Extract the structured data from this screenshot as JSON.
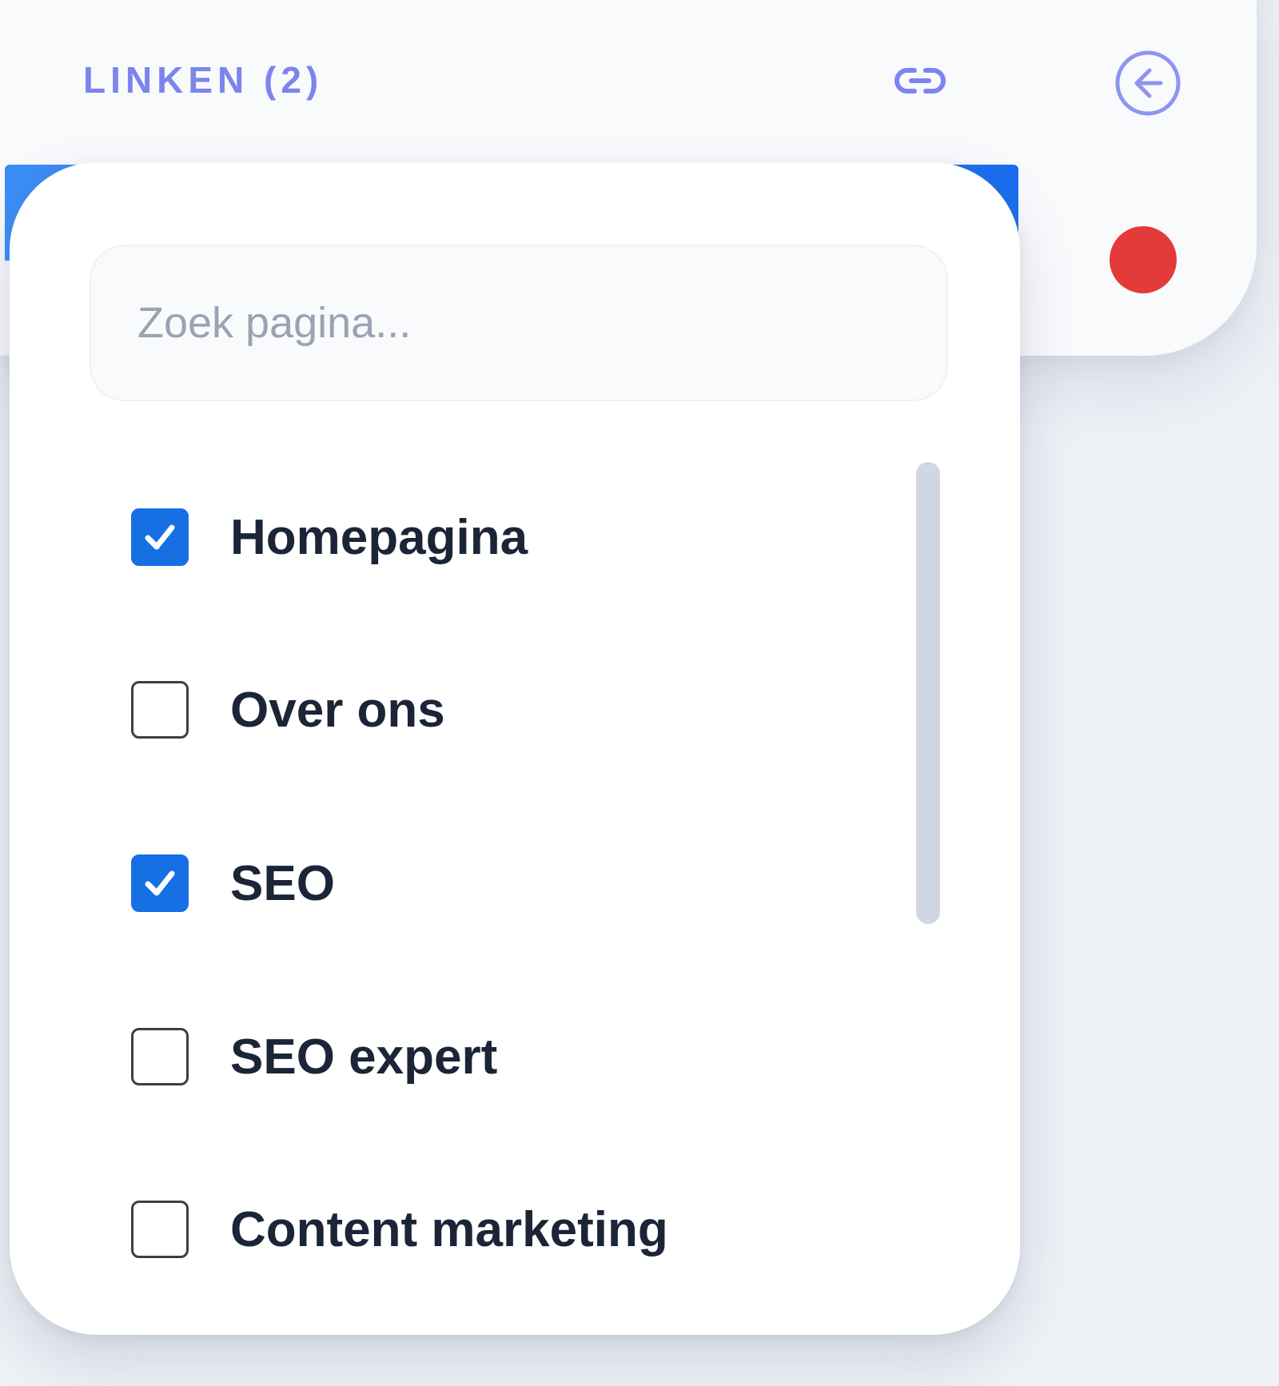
{
  "header": {
    "title": "LINKEN (2)",
    "link_icon": "link-icon",
    "back_icon": "arrow-left-circle-icon"
  },
  "status": {
    "color": "#e53a3a"
  },
  "search": {
    "placeholder": "Zoek pagina...",
    "value": ""
  },
  "options": [
    {
      "label": "Homepagina",
      "checked": true
    },
    {
      "label": "Over ons",
      "checked": false
    },
    {
      "label": "SEO",
      "checked": true
    },
    {
      "label": "SEO expert",
      "checked": false
    },
    {
      "label": "Content marketing",
      "checked": false
    }
  ],
  "colors": {
    "accent": "#176fe4",
    "header_text": "#7c84ee",
    "status_dot": "#e53a3a"
  }
}
